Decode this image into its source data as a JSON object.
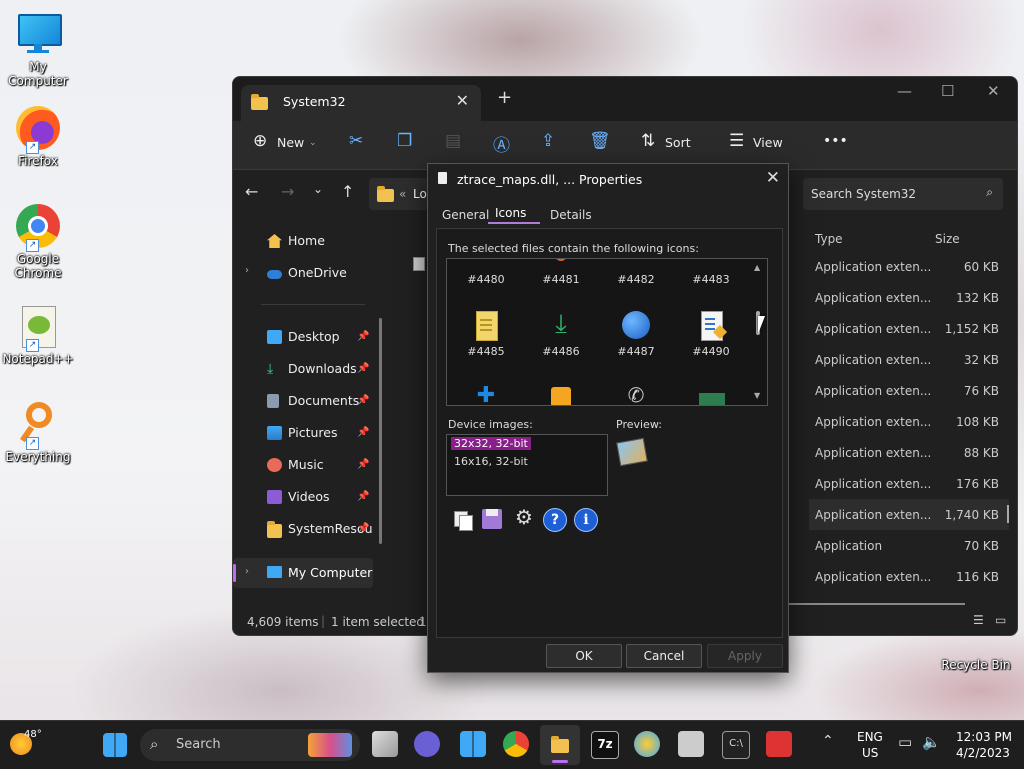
{
  "desktop": {
    "icons": [
      {
        "label": "My Computer",
        "icon": "monitor-icon"
      },
      {
        "label": "Firefox",
        "icon": "firefox-icon"
      },
      {
        "label": "Google Chrome",
        "icon": "chrome-icon"
      },
      {
        "label": "Notepad++",
        "icon": "notepadpp-icon"
      },
      {
        "label": "Everything",
        "icon": "everything-icon"
      },
      {
        "label": "Recycle Bin",
        "icon": "recycle-bin-icon"
      }
    ]
  },
  "explorer": {
    "tab_title": "System32",
    "toolbar": {
      "new": "New",
      "sort": "Sort",
      "view": "View",
      "more": "•••"
    },
    "address_partial": "Lo",
    "search_placeholder": "Search System32",
    "nav": {
      "home": "Home",
      "onedrive": "OneDrive",
      "desktop": "Desktop",
      "downloads": "Downloads",
      "documents": "Documents",
      "pictures": "Pictures",
      "music": "Music",
      "videos": "Videos",
      "systemresou": "SystemResou",
      "mycomputer": "My Computer"
    },
    "columns": {
      "type": "Type",
      "size": "Size"
    },
    "rows": [
      {
        "type": "Application exten...",
        "size": "60 KB"
      },
      {
        "type": "Application exten...",
        "size": "132 KB"
      },
      {
        "type": "Application exten...",
        "size": "1,152 KB"
      },
      {
        "type": "Application exten...",
        "size": "32 KB"
      },
      {
        "type": "Application exten...",
        "size": "76 KB"
      },
      {
        "type": "Application exten...",
        "size": "108 KB"
      },
      {
        "type": "Application exten...",
        "size": "88 KB"
      },
      {
        "type": "Application exten...",
        "size": "176 KB"
      },
      {
        "type": "Application exten...",
        "size": "1,740 KB"
      },
      {
        "type": "Application",
        "size": "70 KB"
      },
      {
        "type": "Application exten...",
        "size": "116 KB"
      }
    ],
    "status": {
      "items": "4,609 items",
      "selected": "1 item selected",
      "tail": "1."
    }
  },
  "dialog": {
    "title": "ztrace_maps.dll, ... Properties",
    "tabs": {
      "general": "General",
      "icons": "Icons",
      "details": "Details"
    },
    "caption": "The selected files contain the following icons:",
    "icons": [
      {
        "label": "#4480"
      },
      {
        "label": "#4481"
      },
      {
        "label": "#4482"
      },
      {
        "label": "#4483"
      },
      {
        "label": "#4485"
      },
      {
        "label": "#4486"
      },
      {
        "label": "#4487"
      },
      {
        "label": "#4490"
      }
    ],
    "device_images_label": "Device images:",
    "device_images": [
      "32x32, 32-bit",
      "16x16, 32-bit"
    ],
    "preview_label": "Preview:",
    "buttons": {
      "ok": "OK",
      "cancel": "Cancel",
      "apply": "Apply"
    }
  },
  "taskbar": {
    "weather": "48°",
    "search": "Search",
    "lang1": "ENG",
    "lang2": "US",
    "time": "12:03 PM",
    "date": "4/2/2023"
  },
  "colors": {
    "accent": "#7b3fa1",
    "selection": "#8a1e8a",
    "folder": "#f2c14e"
  }
}
